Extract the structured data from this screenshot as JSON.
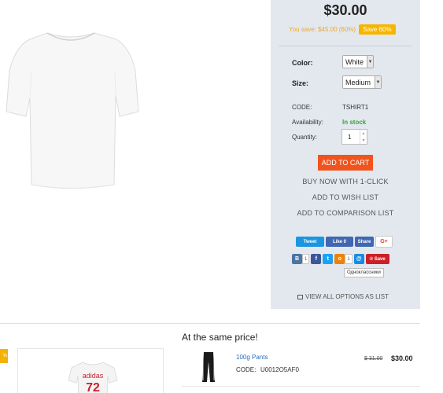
{
  "product": {
    "price": "$30.00",
    "you_save": "You save: $45.00 (60%)",
    "save_badge": "Save 60%",
    "options": {
      "color_label": "Color:",
      "color_value": "White",
      "size_label": "Size:",
      "size_value": "Medium"
    },
    "info": {
      "code_label": "CODE:",
      "code_value": "TSHIRT1",
      "availability_label": "Availability:",
      "availability_value": "In stock",
      "quantity_label": "Quantity:",
      "quantity_value": "1"
    },
    "actions": {
      "add_to_cart": "ADD TO CART",
      "buy_now": "BUY NOW WITH 1-CLICK",
      "wish_list": "ADD TO WISH LIST",
      "comparison": "ADD TO COMPARISON LIST",
      "view_all": "VIEW ALL OPTIONS AS LIST"
    }
  },
  "share": {
    "tweet": "Tweet",
    "like": "Like 0",
    "fb_share": "Share",
    "gplus": "G+",
    "vk_icon": "В",
    "vk_count": "1",
    "fb_icon": "f",
    "tw_icon": "t",
    "ok_icon": "о",
    "ok_count": "1",
    "mail_icon": "@",
    "pin_label": "Save",
    "tooltip": "Одноклассники"
  },
  "same_price": {
    "heading": "At the same price!",
    "tab_text": "%",
    "items": [
      {
        "name": "100g Pants",
        "code_label": "CODE:",
        "code": "U0012O5AF0",
        "old_price": "$ 31.00",
        "price": "$30.00"
      }
    ],
    "card_shirt_text": "adidas 72"
  },
  "colors": {
    "panel_bg": "#e3e8ee",
    "accent_orange": "#f0541e",
    "save_badge": "#f7b500",
    "in_stock": "#3ba33b",
    "link_blue": "#2a6ebb"
  }
}
